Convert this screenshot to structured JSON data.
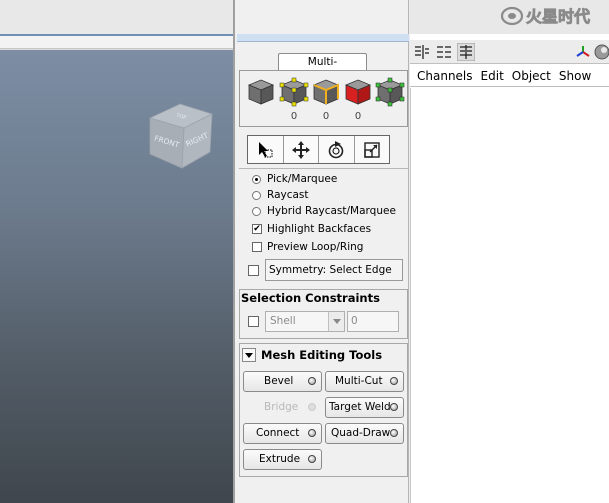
{
  "viewport": {
    "viewcube": {
      "top": "TOP",
      "front": "FRONT",
      "right": "RIGHT"
    }
  },
  "toolkit": {
    "tab_label": "Multi-Component",
    "selection_modes": [
      {
        "name": "object-mode",
        "count": ""
      },
      {
        "name": "vertex-mode",
        "count": "0"
      },
      {
        "name": "edge-mode",
        "count": "0"
      },
      {
        "name": "face-mode",
        "count": "0"
      },
      {
        "name": "uv-mode",
        "count": ""
      }
    ],
    "tools": [
      "select-tool",
      "move-tool",
      "rotate-tool",
      "scale-tool"
    ],
    "pick_options": [
      "Pick/Marquee",
      "Raycast",
      "Hybrid Raycast/Marquee"
    ],
    "pick_selected": "Pick/Marquee",
    "checks": [
      {
        "label": "Highlight Backfaces",
        "checked": true
      },
      {
        "label": "Preview Loop/Ring",
        "checked": false
      }
    ],
    "symmetry": {
      "checked": false,
      "value": "Symmetry: Select Edge"
    },
    "constraints": {
      "title": "Selection Constraints",
      "checked": false,
      "type_value": "Shell",
      "amount_value": "0"
    },
    "mesh_tools": {
      "title": "Mesh Editing Tools",
      "buttons": {
        "bevel": "Bevel",
        "multi_cut": "Multi-Cut",
        "bridge": "Bridge",
        "target_weld": "Target Weld",
        "connect": "Connect",
        "quad_draw": "Quad-Draw",
        "extrude": "Extrude"
      }
    }
  },
  "channel_box": {
    "menu": [
      "Channels",
      "Edit",
      "Object",
      "Show"
    ]
  },
  "watermark": {
    "text": "火星时代",
    "colors": [
      "#ffffff",
      "#7d7d7d"
    ]
  },
  "colors": {
    "face_select": "#e02828",
    "vertex_select": "#d8d000",
    "edge_select": "#e0a020",
    "uv_select": "#3fae3f"
  }
}
